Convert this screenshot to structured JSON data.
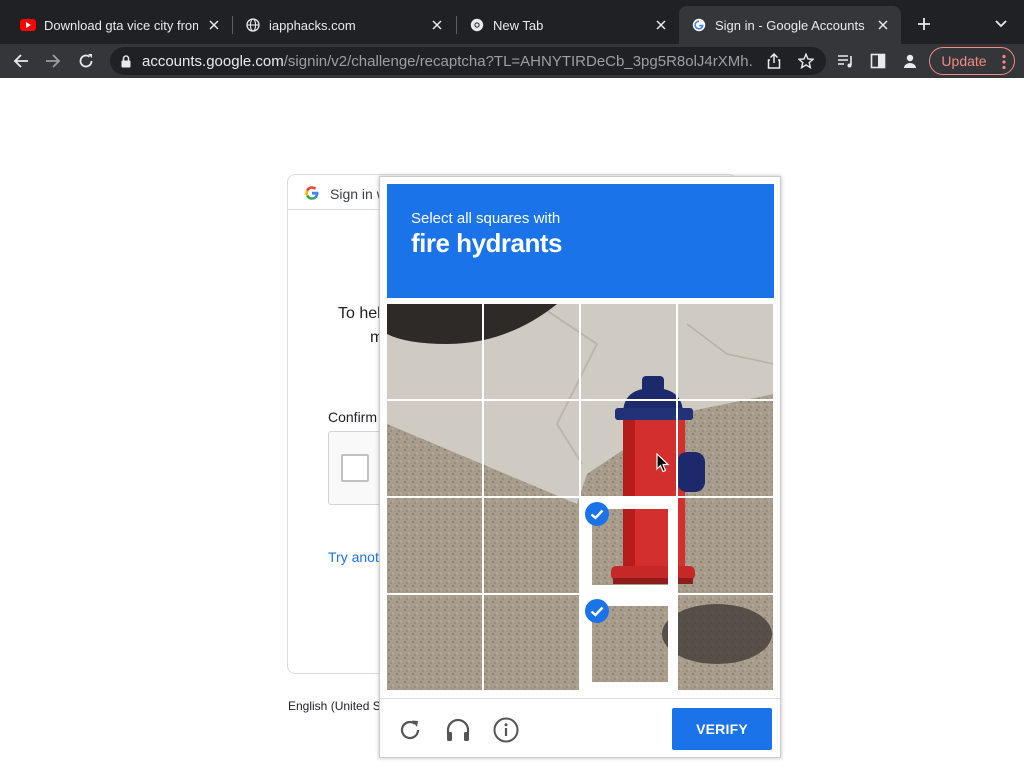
{
  "browser": {
    "tabs": [
      {
        "title": "Download gta vice city from",
        "icon": "youtube-icon"
      },
      {
        "title": "iapphacks.com",
        "icon": "globe-icon"
      },
      {
        "title": "New Tab",
        "icon": "chrome-icon"
      },
      {
        "title": "Sign in - Google Accounts",
        "icon": "google-icon",
        "active": true
      }
    ],
    "url_host": "accounts.google.com",
    "url_path": "/signin/v2/challenge/recaptcha?TL=AHNYTIRDeCb_3pg5R8olJ4rXMh...",
    "update_label": "Update"
  },
  "signin": {
    "header": "Sign in w",
    "intro_line1": "To hel",
    "intro_line2": "m",
    "confirm_label": "Confirm",
    "try_another": "Try anot",
    "language": "English (United S"
  },
  "challenge": {
    "prompt": "Select all squares with",
    "target": "fire hydrants",
    "selected_tiles": [
      10,
      14
    ],
    "verify_label": "VERIFY"
  },
  "colors": {
    "accent": "#1a73e8",
    "hydrant_red": "#d32f2f",
    "hydrant_cap": "#1c2a6b",
    "update": "#f28b82"
  }
}
